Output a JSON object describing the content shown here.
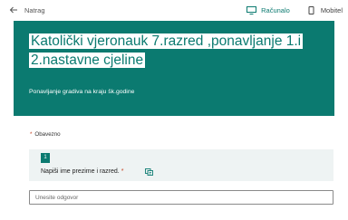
{
  "topbar": {
    "back_label": "Natrag",
    "view_options": [
      {
        "label": "Računalo",
        "icon": "monitor-icon",
        "active": true
      },
      {
        "label": "Mobitel",
        "icon": "phone-icon",
        "active": false
      }
    ]
  },
  "form": {
    "title_line1": "Katolički vjeronauk 7.razred ,ponavljanje 1.i",
    "title_line2": "2.nastavne cjeline",
    "description": "Ponavljanje gradiva na kraju šk.godine",
    "required_note": "Obavezno",
    "questions": [
      {
        "number": "1",
        "text": "Napiši ime prezime i razred.",
        "required_marker": "*",
        "placeholder": "Unesite odgovor"
      }
    ]
  },
  "colors": {
    "brand": "#0b7a70",
    "required": "#c43e1c",
    "question_bg": "#eef3f3"
  }
}
